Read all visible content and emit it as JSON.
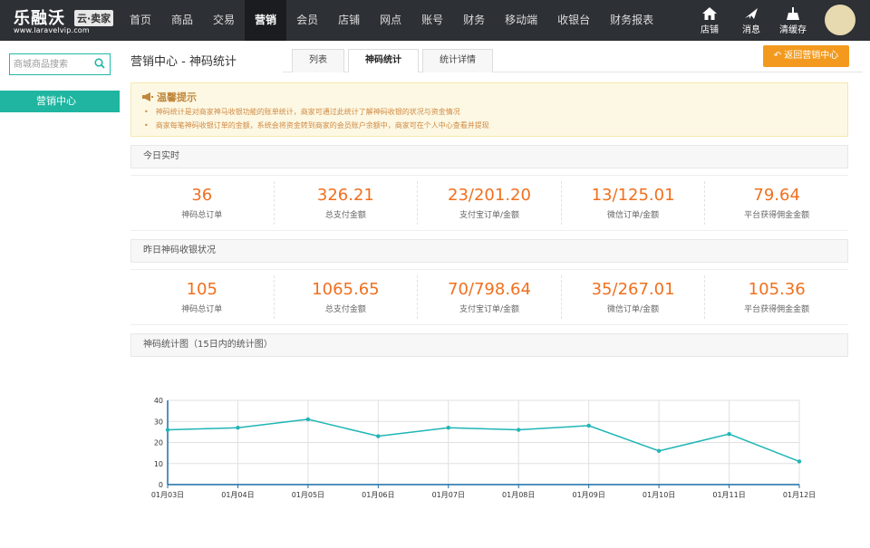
{
  "brand": {
    "name": "乐融沃",
    "tag": "云·卖家",
    "url": "www.laravelvip.com"
  },
  "nav": [
    "首页",
    "商品",
    "交易",
    "营销",
    "会员",
    "店铺",
    "网点",
    "账号",
    "财务",
    "移动端",
    "收银台",
    "财务报表"
  ],
  "nav_active": 3,
  "top_icons": [
    {
      "icon": "store-icon",
      "label": "店铺"
    },
    {
      "icon": "message-icon",
      "label": "消息"
    },
    {
      "icon": "broom-icon",
      "label": "清缓存"
    }
  ],
  "sidebar": {
    "search_placeholder": "商城商品搜索",
    "items": [
      "营销中心"
    ]
  },
  "page": {
    "title": "营销中心 - 神码统计",
    "tabs": [
      "列表",
      "神码统计",
      "统计详情"
    ],
    "active_tab": 1,
    "back_button": "返回营销中心"
  },
  "notice": {
    "title": "温馨提示",
    "lines": [
      "神码统计是对商家神马收银功能的账单统计，商家可通过此统计了解神码收银的状况与资金情况",
      "商家每笔神码收银订单的金额，系统会将资金转到商家的会员账户余额中，商家可在个人中心查看并提现"
    ]
  },
  "today": {
    "heading": "今日实时",
    "stats": [
      {
        "value": "36",
        "label": "神码总订单"
      },
      {
        "value": "326.21",
        "label": "总支付金额"
      },
      {
        "value": "23/201.20",
        "label": "支付宝订单/金额"
      },
      {
        "value": "13/125.01",
        "label": "微信订单/金额"
      },
      {
        "value": "79.64",
        "label": "平台获得佣金金额"
      }
    ]
  },
  "yesterday": {
    "heading": "昨日神码收银状况",
    "stats": [
      {
        "value": "105",
        "label": "神码总订单"
      },
      {
        "value": "1065.65",
        "label": "总支付金额"
      },
      {
        "value": "70/798.64",
        "label": "支付宝订单/金额"
      },
      {
        "value": "35/267.01",
        "label": "微信订单/金额"
      },
      {
        "value": "105.36",
        "label": "平台获得佣金金额"
      }
    ]
  },
  "chart_heading": "神码统计图（15日内的统计图）",
  "colors": {
    "accent": "#1fb5a0",
    "orange": "#f39a1e",
    "line": "#20b5b5",
    "value": "#f0701e"
  },
  "chart_data": {
    "type": "line",
    "categories": [
      "01月03日",
      "01月04日",
      "01月05日",
      "01月06日",
      "01月07日",
      "01月08日",
      "01月09日",
      "01月10日",
      "01月11日",
      "01月12日"
    ],
    "values": [
      26,
      27,
      31,
      23,
      27,
      26,
      28,
      16,
      24,
      11
    ],
    "ylim": [
      0,
      40
    ],
    "yticks": [
      0,
      10,
      20,
      30,
      40
    ],
    "grid": true
  }
}
